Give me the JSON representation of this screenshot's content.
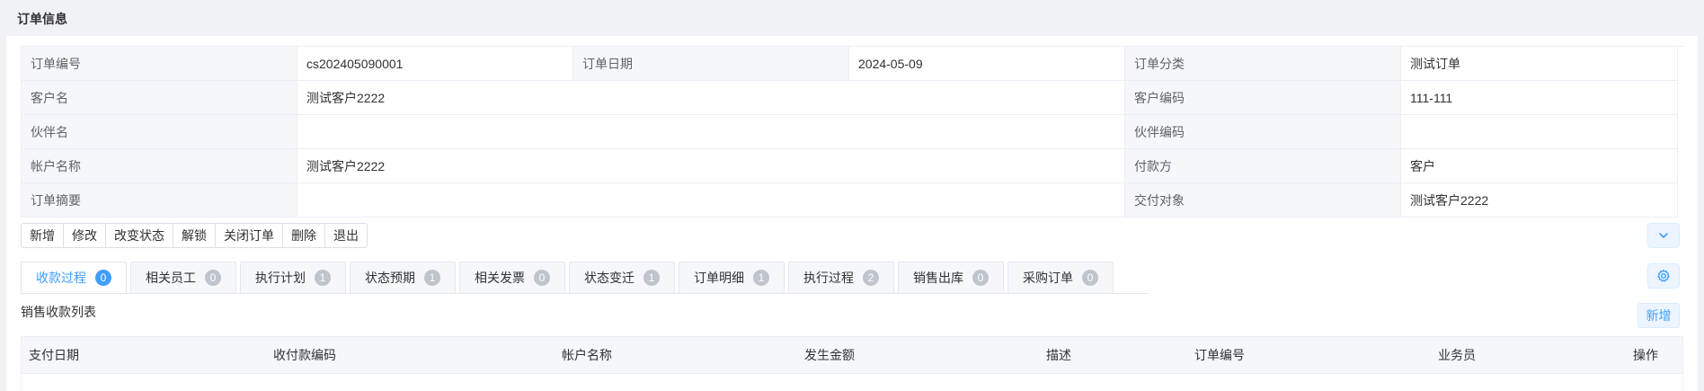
{
  "page": {
    "title": "订单信息"
  },
  "info": {
    "order_no_label": "订单编号",
    "order_no": "cs202405090001",
    "order_date_label": "订单日期",
    "order_date": "2024-05-09",
    "order_type_label": "订单分类",
    "order_type": "测试订单",
    "customer_name_label": "客户名",
    "customer_name": "测试客户2222",
    "customer_code_label": "客户编码",
    "customer_code": "111-111",
    "partner_name_label": "伙伴名",
    "partner_name": "",
    "partner_code_label": "伙伴编码",
    "partner_code": "",
    "account_name_label": "帐户名称",
    "account_name": "测试客户2222",
    "payer_label": "付款方",
    "payer": "客户",
    "summary_label": "订单摘要",
    "summary": "",
    "delivery_target_label": "交付对象",
    "delivery_target": "测试客户2222"
  },
  "toolbar": {
    "add": "新增",
    "edit": "修改",
    "change_status": "改变状态",
    "unlock": "解锁",
    "close_order": "关闭订单",
    "delete": "删除",
    "exit": "退出"
  },
  "tabs": [
    {
      "label": "收款过程",
      "count": "0"
    },
    {
      "label": "相关员工",
      "count": "0"
    },
    {
      "label": "执行计划",
      "count": "1"
    },
    {
      "label": "状态预期",
      "count": "1"
    },
    {
      "label": "相关发票",
      "count": "0"
    },
    {
      "label": "状态变迁",
      "count": "1"
    },
    {
      "label": "订单明细",
      "count": "1"
    },
    {
      "label": "执行过程",
      "count": "2"
    },
    {
      "label": "销售出库",
      "count": "0"
    },
    {
      "label": "采购订单",
      "count": "0"
    }
  ],
  "section": {
    "title": "销售收款列表",
    "add_label": "新增"
  },
  "table": {
    "columns": [
      "支付日期",
      "收付款编码",
      "帐户名称",
      "发生金额",
      "描述",
      "订单编号",
      "业务员",
      "操作"
    ]
  },
  "colors": {
    "accent": "#409eff",
    "badge_inactive": "#c0c4cc",
    "label_bg": "#f5f7fa"
  },
  "icons": {
    "expand": "chevron-down-icon",
    "settings": "gear-icon"
  }
}
